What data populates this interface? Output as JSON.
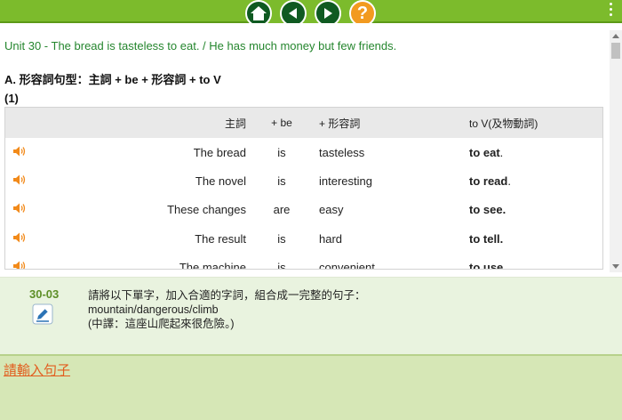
{
  "nav": {
    "buttons": [
      "home-icon",
      "back-icon",
      "forward-icon",
      "help-icon"
    ],
    "help_label": "?",
    "colors": {
      "bar": "#7cbb2c",
      "button": "#0f5a21",
      "help": "#f29a1f"
    }
  },
  "lesson": {
    "title": "Unit 30 - The bread is tasteless to eat. / He has much money but few friends.",
    "section": "A. 形容詞句型：主詞  + be + 形容詞 + to V",
    "sub_label": "(1)"
  },
  "table": {
    "headers": [
      "主詞",
      "+ be",
      "+ 形容詞",
      "to V(及物動詞)"
    ],
    "rows": [
      {
        "subject": "The bread",
        "be": "is",
        "adj": "tasteless",
        "to_v": "to eat",
        "trail": "."
      },
      {
        "subject": "The novel",
        "be": "is",
        "adj": "interesting",
        "to_v": "to read",
        "trail": "."
      },
      {
        "subject": "These changes",
        "be": "are",
        "adj": "easy",
        "to_v": "to see.",
        "trail": ""
      },
      {
        "subject": "The result",
        "be": "is",
        "adj": "hard",
        "to_v": "to tell.",
        "trail": ""
      },
      {
        "subject": "The machine",
        "be": "is",
        "adj": "convenient",
        "to_v": "to use",
        "trail": "."
      }
    ]
  },
  "question": {
    "number": "30-03",
    "instruction": "請將以下單字，加入合適的字詞，組合成一完整的句子：",
    "words": "mountain/dangerous/climb",
    "translation": "(中譯：這座山爬起來很危險。)"
  },
  "answer": {
    "prompt": "請輸入句子"
  }
}
